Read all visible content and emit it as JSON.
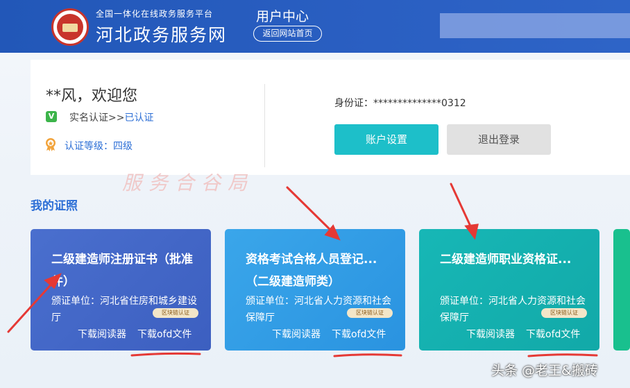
{
  "header": {
    "platform_sub": "全国一体化在线政务服务平台",
    "platform_title": "河北政务服务网",
    "user_center": "用户中心",
    "back_home": "返回网站首页"
  },
  "profile": {
    "greeting": "**风，欢迎您",
    "v_badge": "V",
    "realname_label": "实名认证>>",
    "realname_status": "已认证",
    "level": "认证等级：四级",
    "idcard": "身份证：**************0312",
    "account_settings": "账户设置",
    "logout": "退出登录"
  },
  "watermark": "服务合谷局",
  "section_title": "我的证照",
  "cards": [
    {
      "title": "二级建造师注册证书（批准件）",
      "issuer": "颁证单位：河北省住房和城乡建设厅",
      "badge": "区块链认证",
      "download_reader": "下载阅读器",
      "download_ofd": "下载ofd文件"
    },
    {
      "title": "资格考试合格人员登记...（二级建造师类）",
      "issuer": "颁证单位：河北省人力资源和社会保障厅",
      "badge": "区块链认证",
      "download_reader": "下载阅读器",
      "download_ofd": "下载ofd文件"
    },
    {
      "title": "二级建造师职业资格证...",
      "issuer": "颁证单位：河北省人力资源和社会保障厅",
      "badge": "区块链认证",
      "download_reader": "下载阅读器",
      "download_ofd": "下载ofd文件"
    }
  ],
  "footer_watermark": "头条 @老王&搬砖",
  "colors": {
    "header_bg": "#2257b8",
    "accent_blue": "#2d6fd6",
    "account_btn": "#1dbfc9",
    "card1": "#4a6fce",
    "card2": "#3aa6ea",
    "card3": "#17b7b6",
    "annotation_red": "#e53935"
  }
}
